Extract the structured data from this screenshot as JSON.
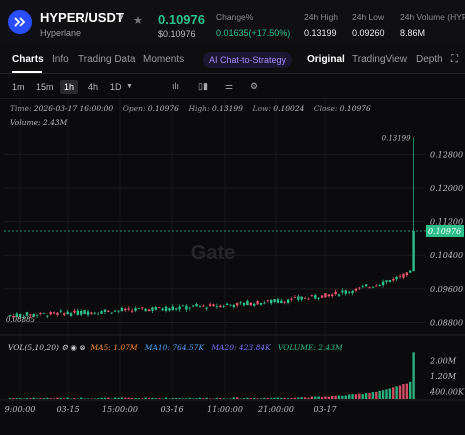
{
  "header": {
    "pair": "HYPER/USDT",
    "network": "Hyperlane",
    "price": "0.10976",
    "price_usd": "$0.10976",
    "change_label": "Change%",
    "change_value": "0.01635(+17.50%)",
    "high_label": "24h High",
    "high_value": "0.13199",
    "low_label": "24h Low",
    "low_value": "0.09260",
    "volume_label": "24h Volume (HYPE",
    "volume_value": "8.86M"
  },
  "tabs": [
    "Charts",
    "Info",
    "Trading Data",
    "Moments"
  ],
  "ai_tab": "AI Chat-to-Strategy",
  "view_tabs": [
    "Original",
    "TradingView",
    "Depth"
  ],
  "timeframes": [
    "1m",
    "15m",
    "1h",
    "4h",
    "1D"
  ],
  "selected_timeframe": "1h",
  "ohlc": {
    "time_label": "Time:",
    "time": "2026-03-17 16:00:00",
    "open_label": "Open:",
    "open": "0.10976",
    "high_label": "High:",
    "high": "0.13199",
    "low_label": "Low:",
    "low": "0.10024",
    "close_label": "Close:",
    "close": "0.10976",
    "volume_label": "Volume:",
    "volume": "2.43M"
  },
  "indicators": {
    "vol": "VOL(5,10,20)",
    "ma5": "MA5: 1.07M",
    "ma10": "MA10: 764.57K",
    "ma20": "MA20: 423.84K",
    "volume": "VOLUME: 2.43M"
  },
  "watermark": "Gate",
  "colors": {
    "up": "#2ec08b",
    "down": "#e8546a",
    "brand": "#2a4dff"
  },
  "chart_data": {
    "type": "candlestick",
    "price_axis": [
      "0.12800",
      "0.12000",
      "0.11200",
      "0.10400",
      "0.09600",
      "0.08800"
    ],
    "current_price_label": "0.10976",
    "high_marker": "0.13199",
    "low_marker": "0.08885",
    "volume_axis": [
      "2.00M",
      "1.20M",
      "400.00K"
    ],
    "time_axis": [
      "9:00:00",
      "03-15",
      "15:00:00",
      "03-16",
      "11:00:00",
      "21:00:00",
      "03-17"
    ],
    "ylim": [
      0.0855,
      0.1345
    ],
    "vol_max": 2.6
  }
}
